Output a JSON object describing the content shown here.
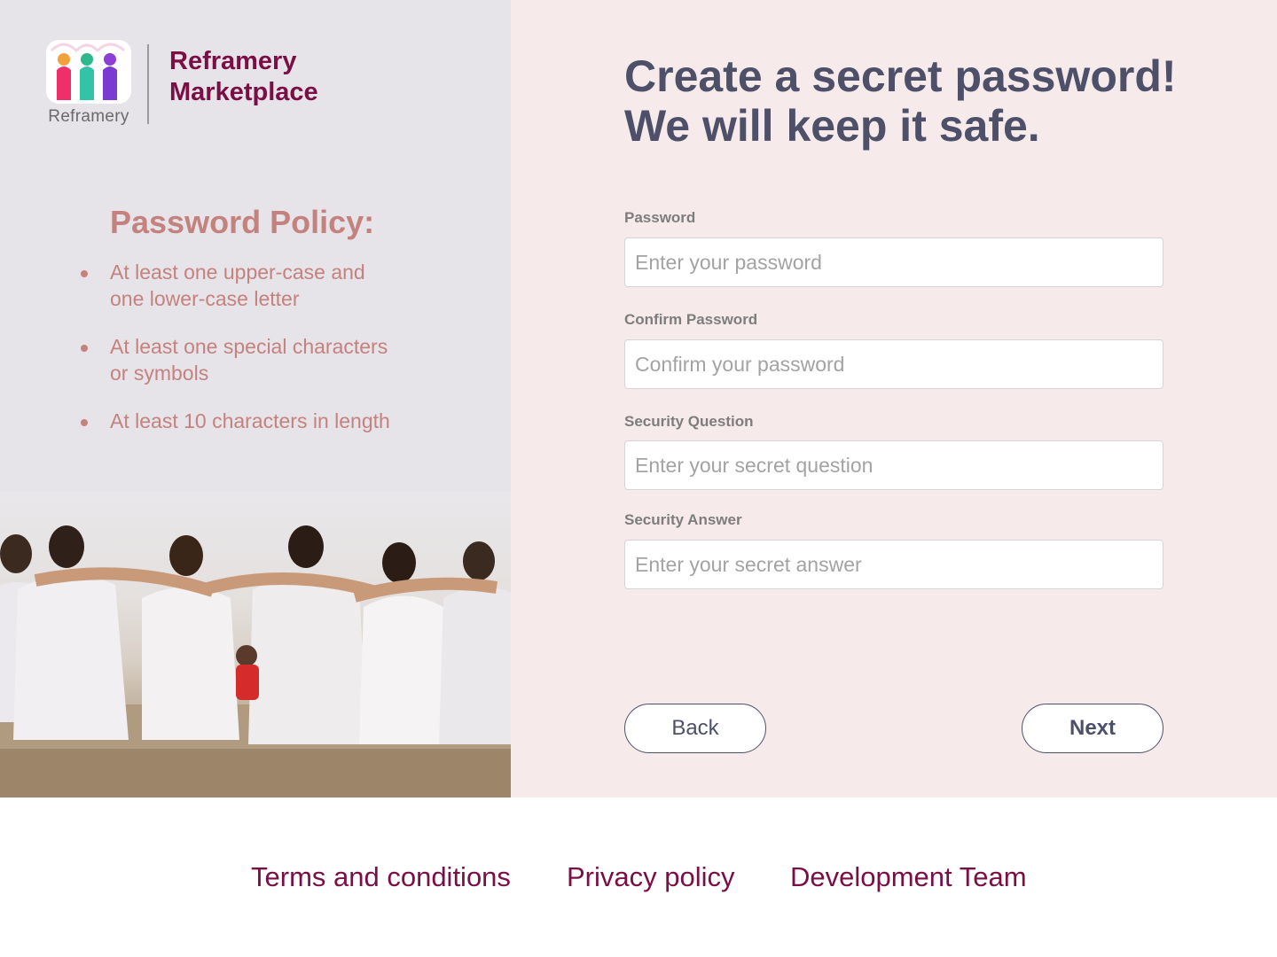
{
  "brand": {
    "logo_word": "Reframery",
    "name_line1": "Reframery",
    "name_line2": "Marketplace",
    "colors": {
      "brand": "#7a0f45",
      "accent": "#c4827e",
      "heading": "#4d5068"
    }
  },
  "policy": {
    "title": "Password Policy:",
    "items": [
      "At least one upper-case and one lower-case letter",
      "At least one special characters or symbols",
      "At least 10 characters in length"
    ]
  },
  "photo": {
    "icon": "group-of-friends-photo"
  },
  "form": {
    "headline_line1": "Create a secret password!",
    "headline_line2": "We will keep it safe.",
    "password": {
      "label": "Password",
      "placeholder": "Enter your password",
      "value": ""
    },
    "confirm": {
      "label": "Confirm Password",
      "placeholder": "Confirm your password",
      "value": ""
    },
    "question": {
      "label": "Security Question",
      "placeholder": "Enter your secret question",
      "value": ""
    },
    "answer": {
      "label": "Security Answer",
      "placeholder": "Enter your secret answer",
      "value": ""
    },
    "back_label": "Back",
    "next_label": "Next"
  },
  "footer": {
    "links": [
      "Terms and conditions",
      "Privacy policy",
      "Development Team"
    ]
  }
}
